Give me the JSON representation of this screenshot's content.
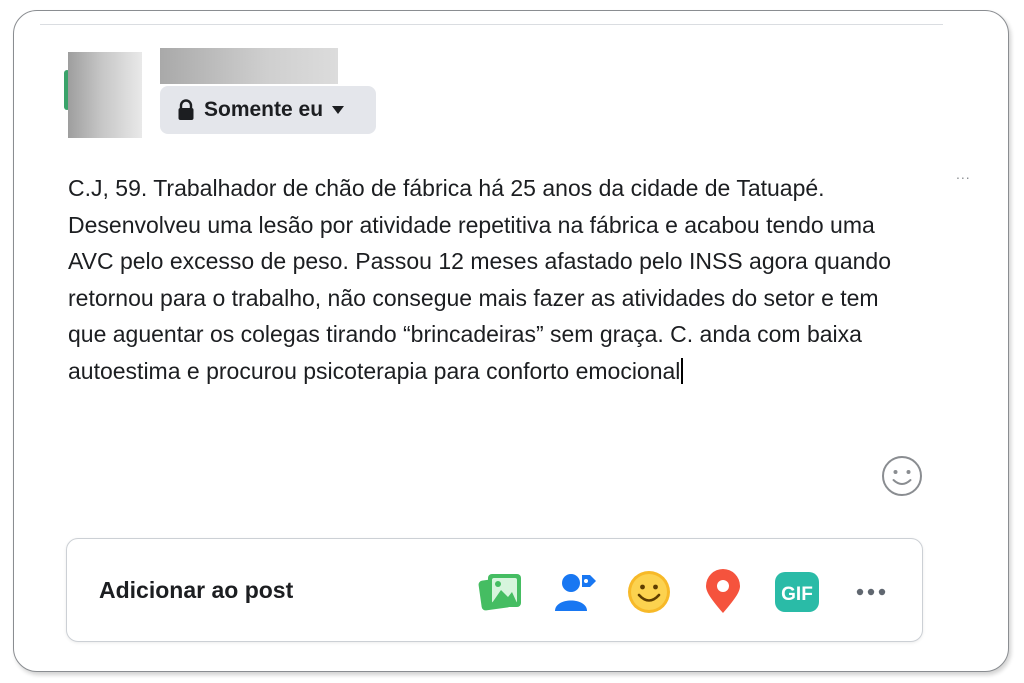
{
  "composer": {
    "privacy_label": "Somente eu",
    "more_dots": "...",
    "text": "C.J, 59. Trabalhador de chão de fábrica há 25 anos da cidade de Tatuapé. Desenvolveu uma lesão por atividade repetitiva na fábrica e acabou tendo uma AVC pelo excesso de peso. Passou 12 meses afastado pelo INSS agora quando retornou para o trabalho, não consegue mais fazer as atividades do setor e tem que aguentar os colegas tirando “brincadeiras” sem graça. C. anda com baixa autoestima e procurou psicoterapia para conforto emocional"
  },
  "add_to_post": {
    "label": "Adicionar ao post",
    "tools": [
      {
        "icon": "photo-video-icon",
        "color": "#45bd62"
      },
      {
        "icon": "tag-people-icon",
        "color": "#1877f2"
      },
      {
        "icon": "feeling-icon",
        "color": "#f7b928"
      },
      {
        "icon": "check-in-icon",
        "color": "#f5533d"
      },
      {
        "icon": "gif-icon",
        "label": "GIF",
        "color": "#2abba7"
      },
      {
        "icon": "more-options-icon",
        "color": "#606770"
      }
    ]
  }
}
